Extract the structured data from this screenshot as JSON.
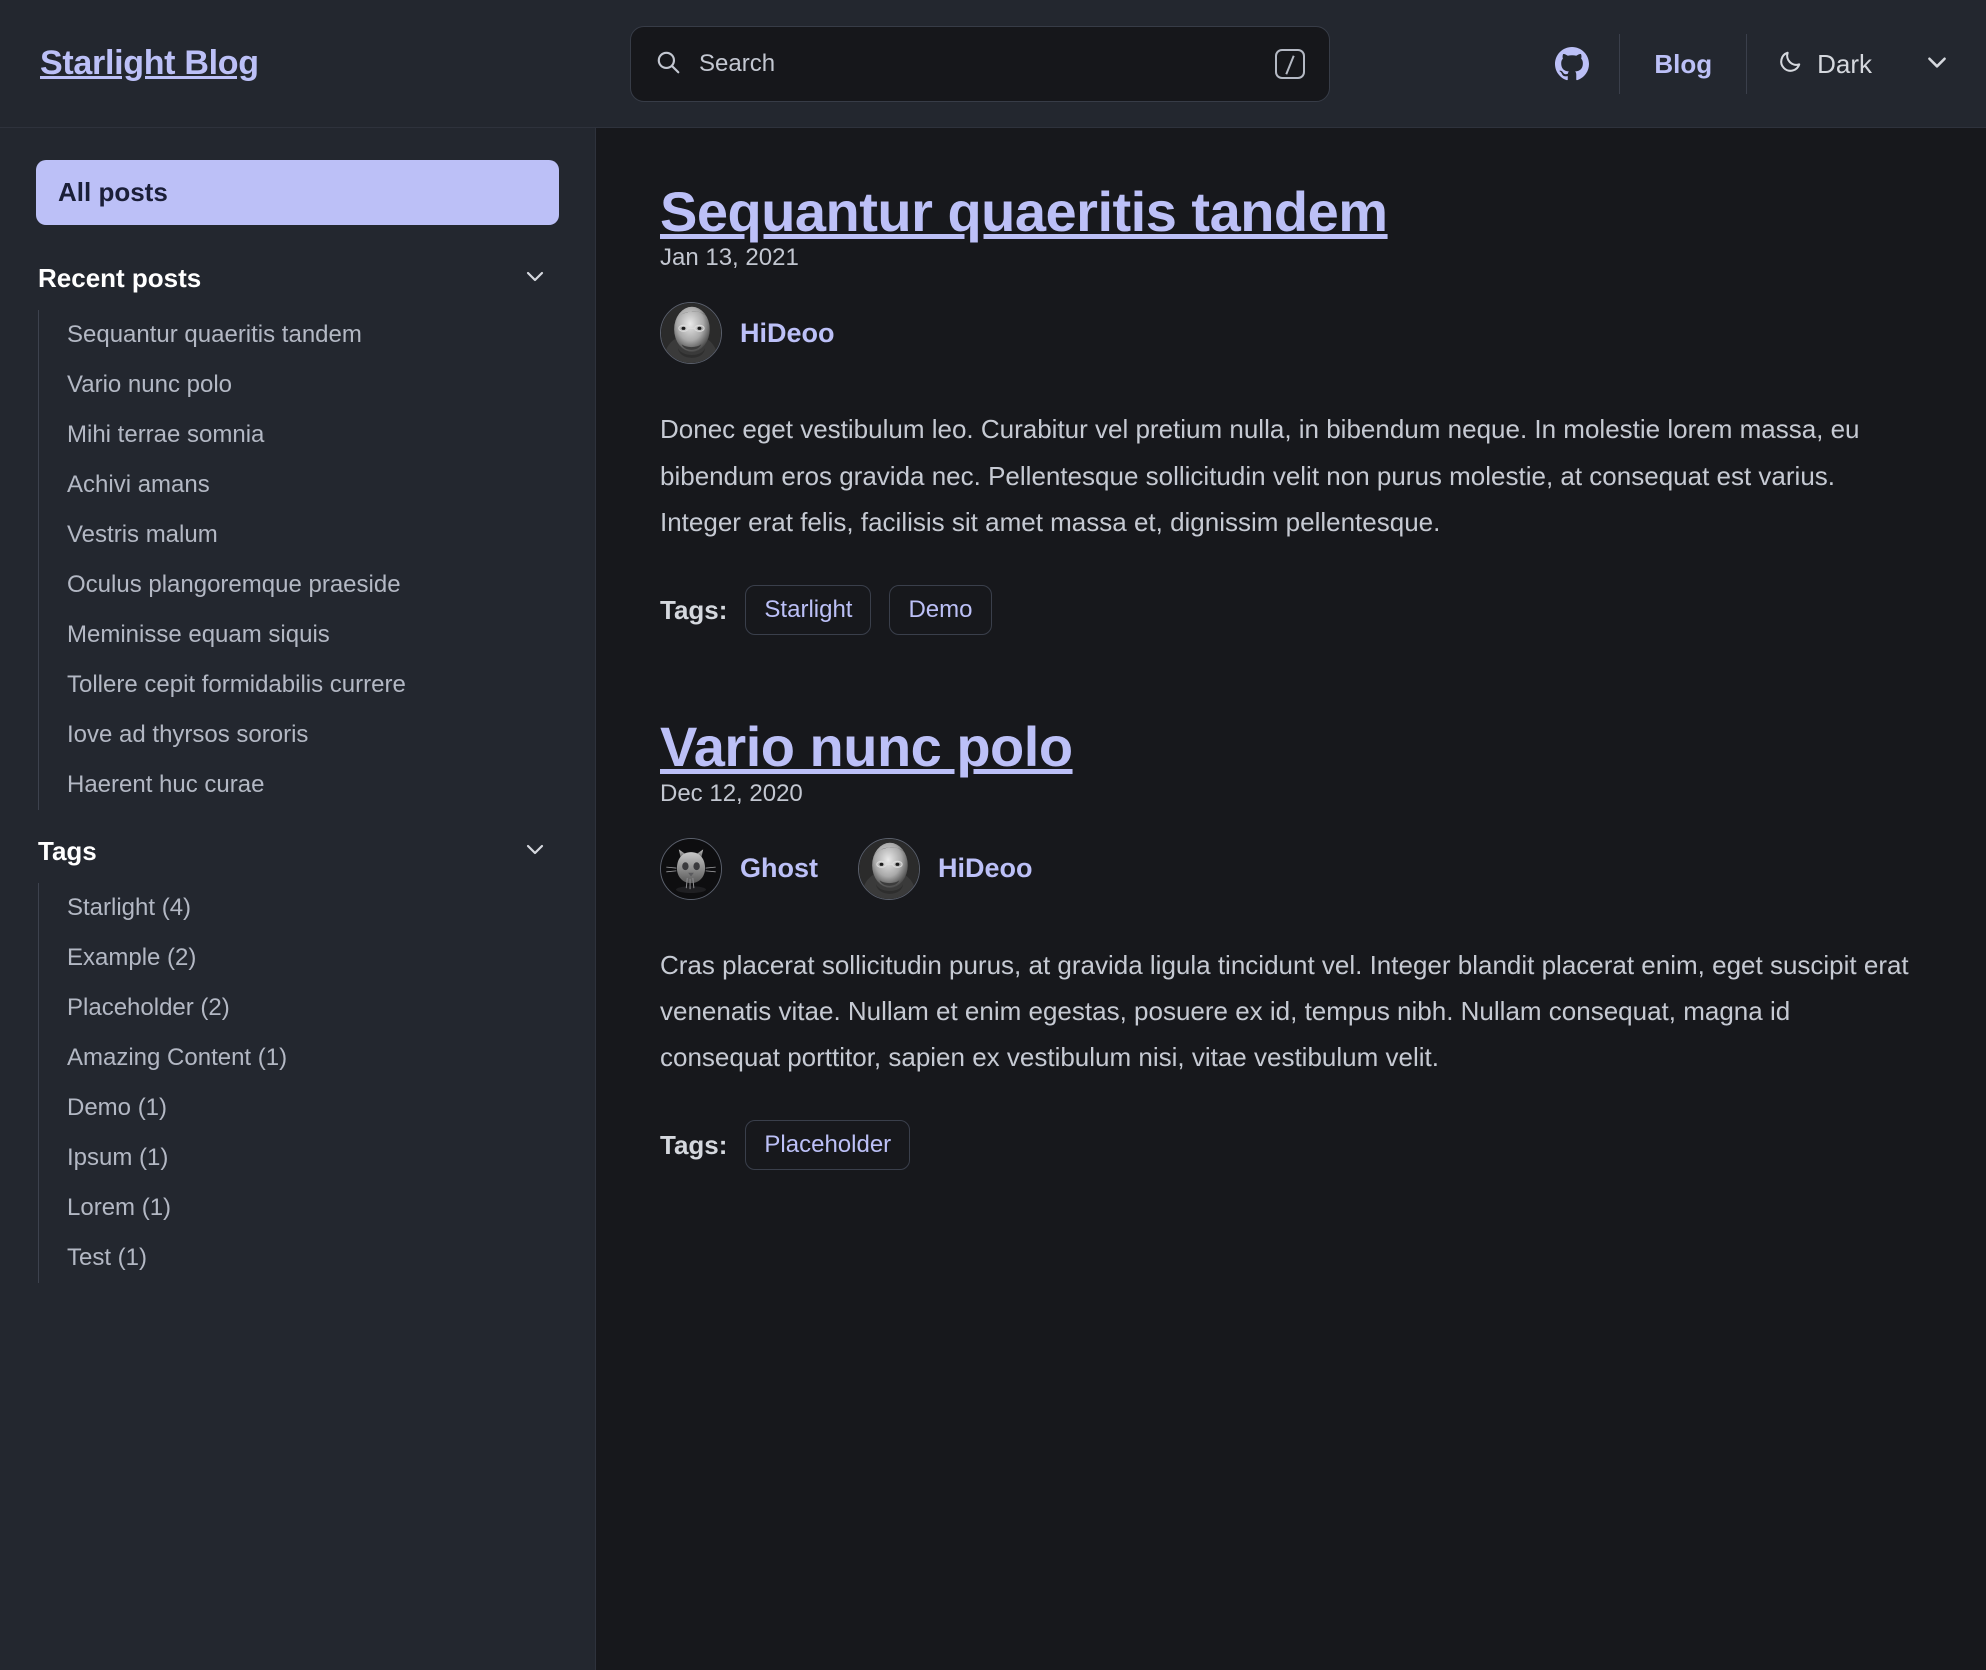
{
  "header": {
    "site_title": "Starlight Blog",
    "search": {
      "placeholder": "Search",
      "shortcut_key": "/"
    },
    "github_label": "GitHub",
    "blog_link": "Blog",
    "theme": {
      "label": "Dark",
      "icon": "moon-icon"
    },
    "accent_color": "#bcc0f7"
  },
  "sidebar": {
    "all_posts_label": "All posts",
    "groups": [
      {
        "title": "Recent posts",
        "items": [
          {
            "label": "Sequantur quaeritis tandem"
          },
          {
            "label": "Vario nunc polo"
          },
          {
            "label": "Mihi terrae somnia"
          },
          {
            "label": "Achivi amans"
          },
          {
            "label": "Vestris malum"
          },
          {
            "label": "Oculus plangoremque praeside"
          },
          {
            "label": "Meminisse equam siquis"
          },
          {
            "label": "Tollere cepit formidabilis currere"
          },
          {
            "label": "Iove ad thyrsos sororis"
          },
          {
            "label": "Haerent huc curae"
          }
        ]
      },
      {
        "title": "Tags",
        "items": [
          {
            "label": "Starlight (4)"
          },
          {
            "label": "Example (2)"
          },
          {
            "label": "Placeholder (2)"
          },
          {
            "label": "Amazing Content (1)"
          },
          {
            "label": "Demo (1)"
          },
          {
            "label": "Ipsum (1)"
          },
          {
            "label": "Lorem (1)"
          },
          {
            "label": "Test (1)"
          }
        ]
      }
    ]
  },
  "main": {
    "tags_label": "Tags:",
    "posts": [
      {
        "title": "Sequantur quaeritis tandem",
        "date": "Jan 13, 2021",
        "authors": [
          {
            "name": "HiDeoo",
            "avatar": "photo-avatar"
          }
        ],
        "body": "Donec eget vestibulum leo. Curabitur vel pretium nulla, in bibendum neque. In molestie lorem massa, eu bibendum eros gravida nec. Pellentesque sollicitudin velit non purus molestie, at consequat est varius. Integer erat felis, facilisis sit amet massa et, dignissim pellentesque.",
        "tags": [
          "Starlight",
          "Demo"
        ]
      },
      {
        "title": "Vario nunc polo",
        "date": "Dec 12, 2020",
        "authors": [
          {
            "name": "Ghost",
            "avatar": "ghost-avatar"
          },
          {
            "name": "HiDeoo",
            "avatar": "photo-avatar"
          }
        ],
        "body": "Cras placerat sollicitudin purus, at gravida ligula tincidunt vel. Integer blandit placerat enim, eget suscipit erat venenatis vitae. Nullam et enim egestas, posuere ex id, tempus nibh. Nullam consequat, magna id consequat porttitor, sapien ex vestibulum nisi, vitae vestibulum velit.",
        "tags": [
          "Placeholder"
        ]
      }
    ]
  }
}
